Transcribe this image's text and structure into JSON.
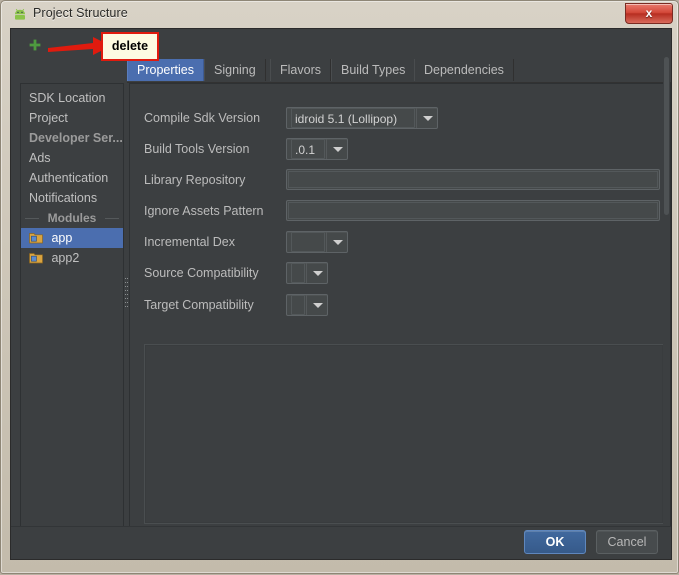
{
  "window": {
    "title": "Project Structure",
    "icon": "android-studio-icon",
    "close_label": "x"
  },
  "toolbar": {
    "add_icon": "plus-icon"
  },
  "annotation": {
    "callout_text": "delete",
    "arrow_icon": "right-arrow-icon",
    "accent_color": "#e01b0e",
    "callout_bg": "#fdfbe2"
  },
  "tabs": [
    {
      "label": "Properties",
      "selected": true
    },
    {
      "label": "Signing",
      "selected": false
    },
    {
      "label": "Flavors",
      "selected": false
    },
    {
      "label": "Build Types",
      "selected": false
    },
    {
      "label": "Dependencies",
      "selected": false
    }
  ],
  "sidebar": {
    "items": [
      {
        "label": "SDK Location",
        "type": "item",
        "selected": false
      },
      {
        "label": "Project",
        "type": "item",
        "selected": false
      },
      {
        "label": "Developer Ser...",
        "type": "group-plain",
        "selected": false
      },
      {
        "label": "Ads",
        "type": "item",
        "selected": false
      },
      {
        "label": "Authentication",
        "type": "item",
        "selected": false
      },
      {
        "label": "Notifications",
        "type": "item",
        "selected": false
      },
      {
        "label": "Modules",
        "type": "group",
        "selected": false
      },
      {
        "label": "app",
        "type": "module",
        "selected": true,
        "icon": "module-icon"
      },
      {
        "label": "app2",
        "type": "module",
        "selected": false,
        "icon": "module-icon"
      }
    ]
  },
  "form": {
    "fields": [
      {
        "label": "Compile Sdk Version",
        "control": "combo",
        "value": "idroid 5.1 (Lollipop)"
      },
      {
        "label": "Build Tools Version",
        "control": "combo",
        "value": ".0.1"
      },
      {
        "label": "Library Repository",
        "control": "text",
        "value": "",
        "placeholder": ""
      },
      {
        "label": "Ignore Assets Pattern",
        "control": "text",
        "value": "",
        "placeholder": ""
      },
      {
        "label": "Incremental Dex",
        "control": "combo",
        "value": ""
      },
      {
        "label": "Source Compatibility",
        "control": "combo",
        "value": ""
      },
      {
        "label": "Target Compatibility",
        "control": "combo",
        "value": ""
      }
    ]
  },
  "buttons": {
    "ok_label": "OK",
    "cancel_label": "Cancel"
  },
  "colors": {
    "selection": "#4b6eaf",
    "panel_bg": "#3c3f41",
    "frame": "#cfc8ba"
  }
}
